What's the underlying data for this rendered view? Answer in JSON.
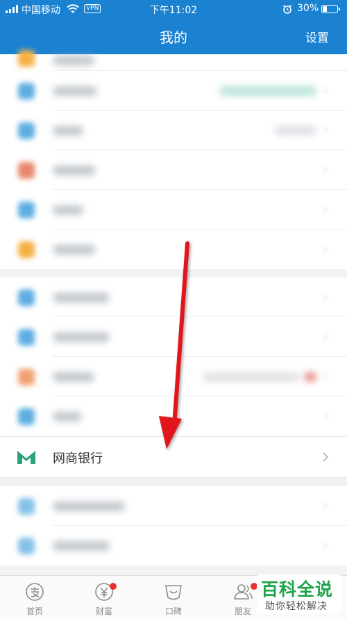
{
  "status_bar": {
    "carrier": "中国移动",
    "vpn_label": "VPN",
    "time": "下午11:02",
    "battery_percent_text": "30%",
    "battery_level": 0.3
  },
  "header": {
    "title": "我的",
    "settings_label": "设置"
  },
  "blurred_rows_section1": [
    {
      "icon_color": "#f5b041",
      "partial": true
    },
    {
      "icon_color": "#5dade2",
      "detail_color": "#8fd3c1"
    },
    {
      "icon_color": "#5dade2",
      "detail_color": "#c9ced4"
    },
    {
      "icon_color": "#e8866a"
    },
    {
      "icon_color": "#5dade2"
    },
    {
      "icon_color": "#f5b041"
    }
  ],
  "blurred_rows_section2": [
    {
      "icon_color": "#5dade2"
    },
    {
      "icon_color": "#5dade2"
    },
    {
      "icon_color": "#f0a070",
      "detail_color": "#d9a3a3"
    },
    {
      "icon_color": "#5dade2"
    }
  ],
  "bank_row": {
    "label": "网商银行",
    "icon": "mybank-logo-icon",
    "brand_color": "#2aa37c"
  },
  "blurred_rows_section3": [
    {
      "icon_color": "#85c1e9"
    },
    {
      "icon_color": "#85c1e9"
    }
  ],
  "annotation": {
    "arrow_color": "#e0141e"
  },
  "tabbar": {
    "tabs": [
      {
        "label": "首页",
        "icon": "alipay-home-icon"
      },
      {
        "label": "财富",
        "icon": "wealth-yen-icon",
        "badge": true
      },
      {
        "label": "口碑",
        "icon": "koubei-icon"
      },
      {
        "label": "朋友",
        "icon": "friends-icon",
        "badge": true
      }
    ]
  },
  "watermark": {
    "title": "百科全说",
    "subtitle": "助你轻松解决"
  }
}
